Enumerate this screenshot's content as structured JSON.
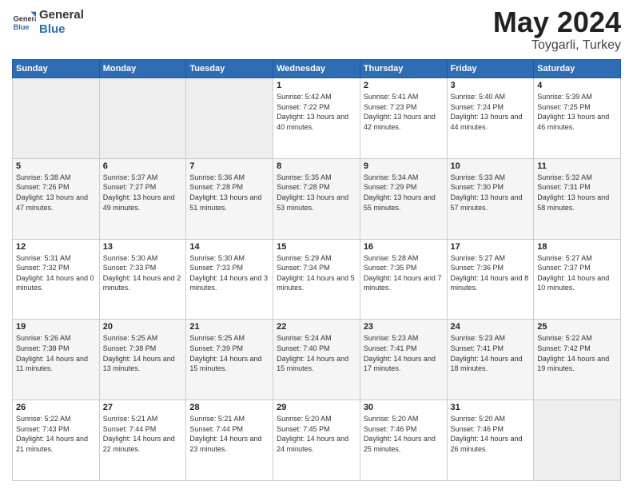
{
  "header": {
    "logo_general": "General",
    "logo_blue": "Blue",
    "title": "May 2024",
    "location": "Toygarli, Turkey"
  },
  "days_of_week": [
    "Sunday",
    "Monday",
    "Tuesday",
    "Wednesday",
    "Thursday",
    "Friday",
    "Saturday"
  ],
  "weeks": [
    [
      {
        "day": "",
        "empty": true
      },
      {
        "day": "",
        "empty": true
      },
      {
        "day": "",
        "empty": true
      },
      {
        "day": "1",
        "sunrise": "5:42 AM",
        "sunset": "7:22 PM",
        "daylight": "13 hours and 40 minutes."
      },
      {
        "day": "2",
        "sunrise": "5:41 AM",
        "sunset": "7:23 PM",
        "daylight": "13 hours and 42 minutes."
      },
      {
        "day": "3",
        "sunrise": "5:40 AM",
        "sunset": "7:24 PM",
        "daylight": "13 hours and 44 minutes."
      },
      {
        "day": "4",
        "sunrise": "5:39 AM",
        "sunset": "7:25 PM",
        "daylight": "13 hours and 46 minutes."
      }
    ],
    [
      {
        "day": "5",
        "sunrise": "5:38 AM",
        "sunset": "7:26 PM",
        "daylight": "13 hours and 47 minutes."
      },
      {
        "day": "6",
        "sunrise": "5:37 AM",
        "sunset": "7:27 PM",
        "daylight": "13 hours and 49 minutes."
      },
      {
        "day": "7",
        "sunrise": "5:36 AM",
        "sunset": "7:28 PM",
        "daylight": "13 hours and 51 minutes."
      },
      {
        "day": "8",
        "sunrise": "5:35 AM",
        "sunset": "7:28 PM",
        "daylight": "13 hours and 53 minutes."
      },
      {
        "day": "9",
        "sunrise": "5:34 AM",
        "sunset": "7:29 PM",
        "daylight": "13 hours and 55 minutes."
      },
      {
        "day": "10",
        "sunrise": "5:33 AM",
        "sunset": "7:30 PM",
        "daylight": "13 hours and 57 minutes."
      },
      {
        "day": "11",
        "sunrise": "5:32 AM",
        "sunset": "7:31 PM",
        "daylight": "13 hours and 58 minutes."
      }
    ],
    [
      {
        "day": "12",
        "sunrise": "5:31 AM",
        "sunset": "7:32 PM",
        "daylight": "14 hours and 0 minutes."
      },
      {
        "day": "13",
        "sunrise": "5:30 AM",
        "sunset": "7:33 PM",
        "daylight": "14 hours and 2 minutes."
      },
      {
        "day": "14",
        "sunrise": "5:30 AM",
        "sunset": "7:33 PM",
        "daylight": "14 hours and 3 minutes."
      },
      {
        "day": "15",
        "sunrise": "5:29 AM",
        "sunset": "7:34 PM",
        "daylight": "14 hours and 5 minutes."
      },
      {
        "day": "16",
        "sunrise": "5:28 AM",
        "sunset": "7:35 PM",
        "daylight": "14 hours and 7 minutes."
      },
      {
        "day": "17",
        "sunrise": "5:27 AM",
        "sunset": "7:36 PM",
        "daylight": "14 hours and 8 minutes."
      },
      {
        "day": "18",
        "sunrise": "5:27 AM",
        "sunset": "7:37 PM",
        "daylight": "14 hours and 10 minutes."
      }
    ],
    [
      {
        "day": "19",
        "sunrise": "5:26 AM",
        "sunset": "7:38 PM",
        "daylight": "14 hours and 11 minutes."
      },
      {
        "day": "20",
        "sunrise": "5:25 AM",
        "sunset": "7:38 PM",
        "daylight": "14 hours and 13 minutes."
      },
      {
        "day": "21",
        "sunrise": "5:25 AM",
        "sunset": "7:39 PM",
        "daylight": "14 hours and 15 minutes."
      },
      {
        "day": "22",
        "sunrise": "5:24 AM",
        "sunset": "7:40 PM",
        "daylight": "14 hours and 15 minutes."
      },
      {
        "day": "23",
        "sunrise": "5:23 AM",
        "sunset": "7:41 PM",
        "daylight": "14 hours and 17 minutes."
      },
      {
        "day": "24",
        "sunrise": "5:23 AM",
        "sunset": "7:41 PM",
        "daylight": "14 hours and 18 minutes."
      },
      {
        "day": "25",
        "sunrise": "5:22 AM",
        "sunset": "7:42 PM",
        "daylight": "14 hours and 19 minutes."
      }
    ],
    [
      {
        "day": "26",
        "sunrise": "5:22 AM",
        "sunset": "7:43 PM",
        "daylight": "14 hours and 21 minutes."
      },
      {
        "day": "27",
        "sunrise": "5:21 AM",
        "sunset": "7:44 PM",
        "daylight": "14 hours and 22 minutes."
      },
      {
        "day": "28",
        "sunrise": "5:21 AM",
        "sunset": "7:44 PM",
        "daylight": "14 hours and 23 minutes."
      },
      {
        "day": "29",
        "sunrise": "5:20 AM",
        "sunset": "7:45 PM",
        "daylight": "14 hours and 24 minutes."
      },
      {
        "day": "30",
        "sunrise": "5:20 AM",
        "sunset": "7:46 PM",
        "daylight": "14 hours and 25 minutes."
      },
      {
        "day": "31",
        "sunrise": "5:20 AM",
        "sunset": "7:46 PM",
        "daylight": "14 hours and 26 minutes."
      },
      {
        "day": "",
        "empty": true
      }
    ]
  ],
  "labels": {
    "sunrise": "Sunrise:",
    "sunset": "Sunset:",
    "daylight": "Daylight:"
  }
}
